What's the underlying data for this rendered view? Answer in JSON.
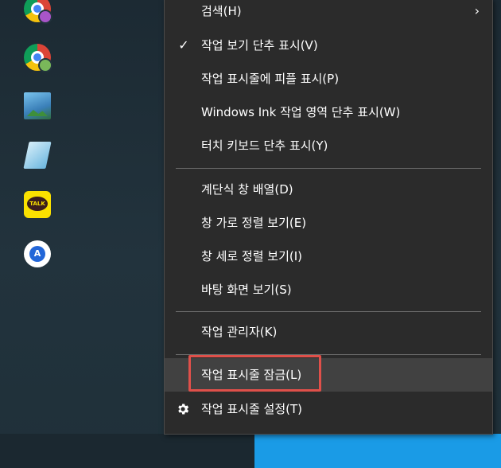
{
  "menu": {
    "items": [
      {
        "label": "검색(H)",
        "submenu": true
      },
      {
        "label": "작업 보기 단추 표시(V)",
        "checked": true
      },
      {
        "label": "작업 표시줄에 피플 표시(P)"
      },
      {
        "label": "Windows Ink 작업 영역 단추 표시(W)"
      },
      {
        "label": "터치 키보드 단추 표시(Y)"
      },
      {
        "label": "계단식 창 배열(D)"
      },
      {
        "label": "창 가로 정렬 보기(E)"
      },
      {
        "label": "창 세로 정렬 보기(I)"
      },
      {
        "label": "바탕 화면 보기(S)"
      },
      {
        "label": "작업 관리자(K)"
      },
      {
        "label": "작업 표시줄 잠금(L)",
        "hovered": true
      },
      {
        "label": "작업 표시줄 설정(T)",
        "icon": "gear-icon"
      }
    ],
    "check_glyph": "✓",
    "submenu_glyph": "›"
  },
  "desktop_icons": [
    {
      "icon": "chrome-profile-icon",
      "badge_color": "#a855c8"
    },
    {
      "icon": "chrome-profile-icon",
      "badge_color": "#7ab85a"
    },
    {
      "icon": "photos-icon"
    },
    {
      "icon": "notepad-icon"
    },
    {
      "icon": "kakaotalk-icon",
      "text": "TALK"
    },
    {
      "icon": "app-store-icon",
      "text": "A"
    }
  ],
  "colors": {
    "menu_bg": "#2b2b2b",
    "menu_hover": "#414141",
    "highlight": "#e0504a",
    "accent_blue": "#1a9be6"
  }
}
